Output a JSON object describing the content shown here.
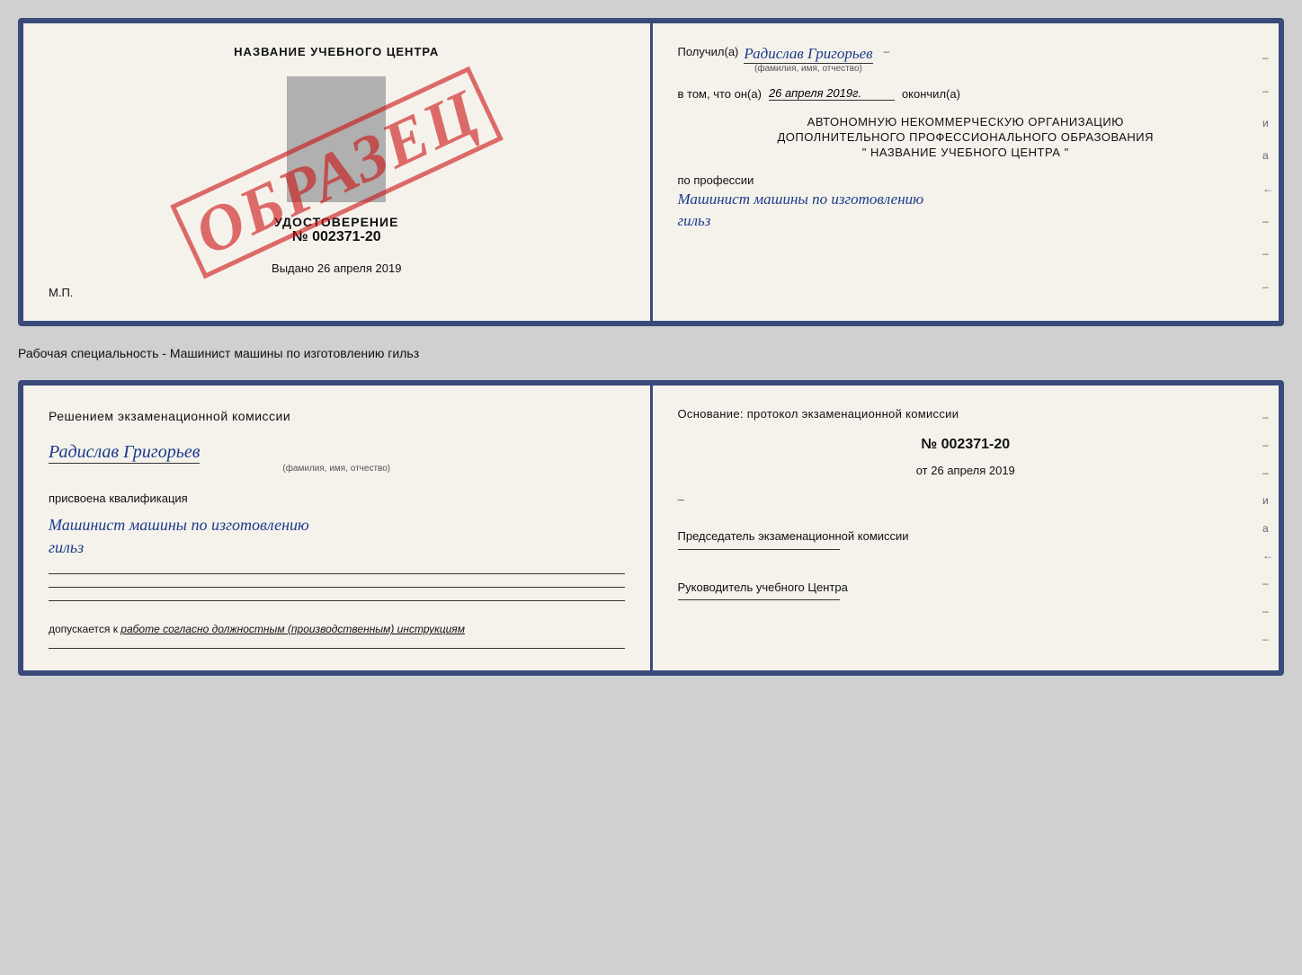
{
  "colors": {
    "border": "#3a4a7a",
    "stamp": "#cc1111",
    "cursive": "#1a3a8a",
    "text": "#111111"
  },
  "top_document": {
    "left": {
      "center_title": "НАЗВАНИЕ УЧЕБНОГО ЦЕНТРА",
      "stamp_text": "ОБРАЗЕЦ",
      "udostoverenie_title": "УДОСТОВЕРЕНИЕ",
      "udostoverenie_num": "№ 002371-20",
      "vydano_label": "Выдано",
      "vydano_date": "26 апреля 2019",
      "mp_label": "М.П."
    },
    "right": {
      "poluchil_label": "Получил(а)",
      "poluchil_name": "Радислав Григорьев",
      "fio_sub": "(фамилия, имя, отчество)",
      "dash": "–",
      "vtom_label": "в том, что он(а)",
      "vtom_date": "26 апреля 2019г.",
      "okonchil_label": "окончил(а)",
      "org_line1": "АВТОНОМНУЮ НЕКОММЕРЧЕСКУЮ ОРГАНИЗАЦИЮ",
      "org_line2": "ДОПОЛНИТЕЛЬНОГО ПРОФЕССИОНАЛЬНОГО ОБРАЗОВАНИЯ",
      "org_name": "\"  НАЗВАНИЕ УЧЕБНОГО ЦЕНТРА  \"",
      "professiya_label": "по профессии",
      "professiya_name1": "Машинист машины по изготовлению",
      "professiya_name2": "гильз"
    }
  },
  "caption": {
    "text": "Рабочая специальность - Машинист машины по изготовлению гильз"
  },
  "bottom_document": {
    "left": {
      "resheniem_title": "Решением  экзаменационной  комиссии",
      "person_name": "Радислав Григорьев",
      "fio_sub": "(фамилия, имя, отчество)",
      "prisvoena_label": "присвоена квалификация",
      "kvalif_name1": "Машинист  машины  по  изготовлению",
      "kvalif_name2": "гильз",
      "dopuskaetsya_label": "допускается к",
      "dopuskaetsya_text": "работе согласно должностным (производственным) инструкциям"
    },
    "right": {
      "osnov_label": "Основание: протокол экзаменационной  комиссии",
      "protocol_num": "№  002371-20",
      "ot_label": "от",
      "ot_date": "26 апреля 2019",
      "predsedatel_label": "Председатель экзаменационной комиссии",
      "rukovoditel_label": "Руководитель учебного Центра"
    }
  }
}
